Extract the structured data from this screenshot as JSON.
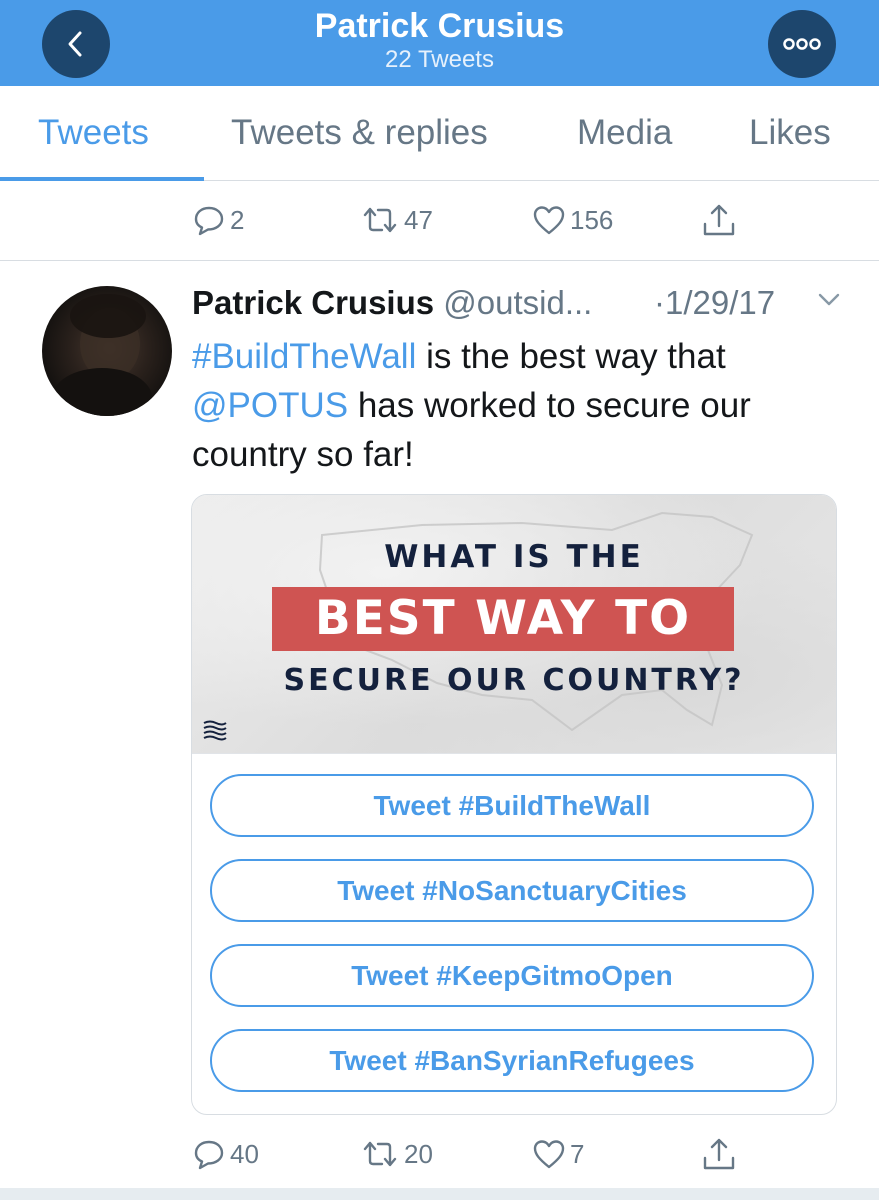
{
  "header": {
    "title": "Patrick Crusius",
    "subtitle": "22 Tweets",
    "back_icon": "chevron-left-icon",
    "more_icon": "more-dots-icon",
    "background": "#4a9be8",
    "button_color": "#1d466d"
  },
  "tabs": [
    {
      "label": "Tweets",
      "active": true
    },
    {
      "label": "Tweets & replies",
      "active": false
    },
    {
      "label": "Media",
      "active": false
    },
    {
      "label": "Likes",
      "active": false
    }
  ],
  "previous_tweet": {
    "replies": "2",
    "retweets": "47",
    "likes": "156"
  },
  "tweet": {
    "name": "Patrick Crusius",
    "handle": "@outsid...",
    "date": "·1/29/17",
    "text_parts": {
      "hashtag": "#BuildTheWall",
      "text1": " is the best way that ",
      "mention": "@POTUS",
      "text2": " has worked to secure our country so far!"
    },
    "card": {
      "image_line1": "WHAT IS THE",
      "image_line2": "BEST WAY TO",
      "image_line3": "SECURE OUR COUNTRY?",
      "buttons": [
        "Tweet #BuildTheWall",
        "Tweet #NoSanctuaryCities",
        "Tweet #KeepGitmoOpen",
        "Tweet #BanSyrianRefugees"
      ]
    },
    "replies": "40",
    "retweets": "20",
    "likes": "7"
  },
  "colors": {
    "accent": "#4a9be8",
    "muted": "#667786",
    "banner_red": "#cf5452",
    "navy_text": "#14213d"
  }
}
